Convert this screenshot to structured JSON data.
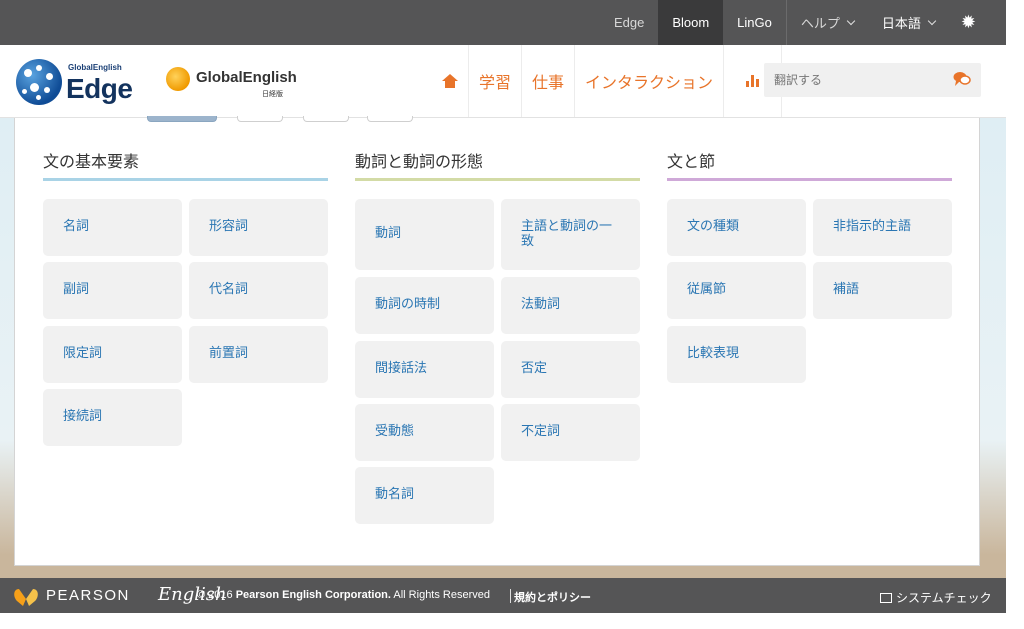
{
  "topbar": {
    "items": [
      {
        "label": "Edge"
      },
      {
        "label": "Bloom"
      },
      {
        "label": "LinGo"
      },
      {
        "label": "ヘルプ"
      },
      {
        "label": "日本語"
      }
    ]
  },
  "header": {
    "logo_edge_small": "GlobalEnglish",
    "logo_edge_big": "Edge",
    "logo_ge_text": "GlobalEnglish",
    "logo_ge_sub": "日経版",
    "nav": [
      {
        "label": "学習"
      },
      {
        "label": "仕事"
      },
      {
        "label": "インタラクション"
      }
    ],
    "search_placeholder": "翻訳する"
  },
  "colors": {
    "accent": "#e8742a",
    "link": "#2a76b3",
    "topbar": "#555556"
  },
  "columns": [
    {
      "title": "文の基本要素",
      "rule_color": "#a9d3e6",
      "tiles": [
        "名詞",
        "形容詞",
        "副詞",
        "代名詞",
        "限定詞",
        "前置詞",
        "接続詞"
      ]
    },
    {
      "title": "動詞と動詞の形態",
      "rule_color": "#d3dba6",
      "tiles": [
        "動詞",
        "主語と動詞の一致",
        "動詞の時制",
        "法動詞",
        "間接話法",
        "否定",
        "受動態",
        "不定詞",
        "動名詞"
      ]
    },
    {
      "title": "文と節",
      "rule_color": "#cfa9d8",
      "tiles": [
        "文の種類",
        "非指示的主語",
        "従属節",
        "補語",
        "比較表現"
      ]
    }
  ],
  "footer": {
    "pearson": "PEARSON",
    "english": "English",
    "copyright_prefix": "© 2016 ",
    "copyright_owner": "Pearson English Corporation.",
    "copyright_suffix": " All Rights Reserved",
    "policy": "規約とポリシー",
    "system_check": "システムチェック"
  }
}
